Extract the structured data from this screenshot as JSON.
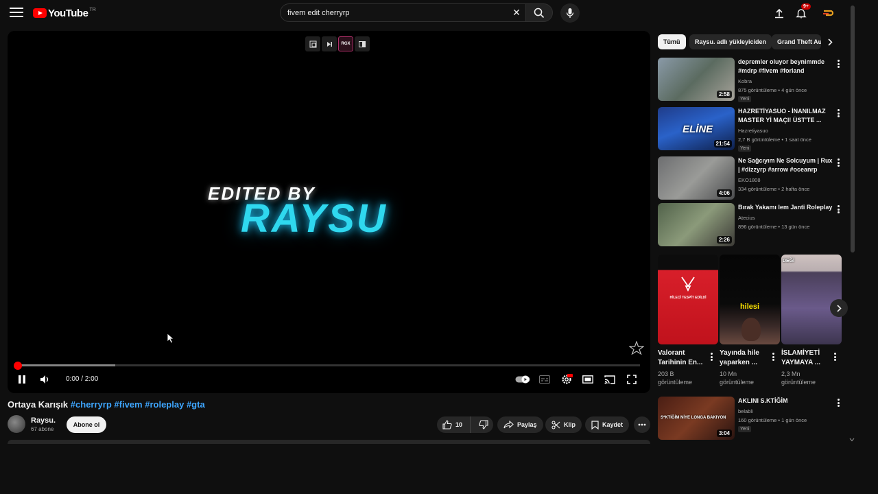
{
  "header": {
    "logo_text": "YouTube",
    "country_code": "TR",
    "search_value": "fivem edit cherryrp",
    "notification_count": "9+",
    "icons": [
      "menu-icon",
      "search-icon",
      "mic-icon",
      "upload-icon",
      "bell-icon",
      "avatar"
    ]
  },
  "player": {
    "extension_label": "RGX",
    "overlay_line1": "EDITED BY",
    "overlay_line2": "RAYSU",
    "time_current": "0:00",
    "time_total": "2:00",
    "time_display": "0:00 / 2:00",
    "progress_played": 0.005,
    "progress_buffered": 0.157
  },
  "video": {
    "title_plain": "Ortaya Karışık",
    "hashtags": [
      "#cherryrp",
      "#fivem",
      "#roleplay",
      "#gta"
    ],
    "channel_name": "Raysu.",
    "subscribers": "67 abone",
    "subscribe_label": "Abone ol",
    "likes": "10",
    "share_label": "Paylaş",
    "clip_label": "Klip",
    "save_label": "Kaydet"
  },
  "sidebar": {
    "chips": [
      "Tümü",
      "Raysu. adlı yükleyiciden",
      "Grand Theft Auto"
    ],
    "recommendations": [
      {
        "title": "depremler oluyor beynimmde #mdrp #fivem #forland",
        "channel": "Kobra",
        "stats": "875 görüntüleme • 4 gün önce",
        "badge": "Yeni",
        "duration": "2:58"
      },
      {
        "title": "HAZRETİYASUO - İNANILMAZ MASTER Yİ MAÇI! ÜST'TE ...",
        "channel": "Hazretiyasuo",
        "stats": "2,7 B görüntüleme • 1 saat önce",
        "badge": "Yeni",
        "duration": "21:54"
      },
      {
        "title": "Ne Sağcıyım Ne Solcuyum | Rux | #dizzyrp #arrow #oceanrp",
        "channel": "EKO1808",
        "stats": "334 görüntüleme • 2 hafta önce",
        "badge": "",
        "duration": "4:06"
      },
      {
        "title": "Bırak Yakamı lem Janti Roleplay",
        "channel": "Atecius",
        "stats": "896 görüntüleme • 13 gün önce",
        "badge": "",
        "duration": "2:26"
      }
    ],
    "shorts": [
      {
        "title": "Valorant Tarihinin En...",
        "views": "203 B görüntüleme",
        "thumb_text": "HİLECİ TESPİT EDİLDİ"
      },
      {
        "title": "Yayında hile yaparken ...",
        "views": "10 Mn görüntüleme",
        "thumb_text": "hilesi"
      },
      {
        "title": "İSLAMİYETİ YAYMAYA ...",
        "views": "2,3 Mn görüntüleme",
        "thumb_text": "DEĞİ"
      }
    ],
    "last_rec": {
      "title": "AKLINI S.KTİĞİM",
      "channel": "belabli",
      "stats": "160 görüntüleme • 1 gün önce",
      "badge": "Yeni",
      "duration": "3:04",
      "thumb_text": "S*KTİĞİM NİYE LONGA BAKIYON"
    }
  },
  "colors": {
    "accent": "#ff0000",
    "link": "#3ea6ff",
    "background": "#0f0f0f",
    "surface": "#272727",
    "title_glow": "#2fd8ef"
  }
}
